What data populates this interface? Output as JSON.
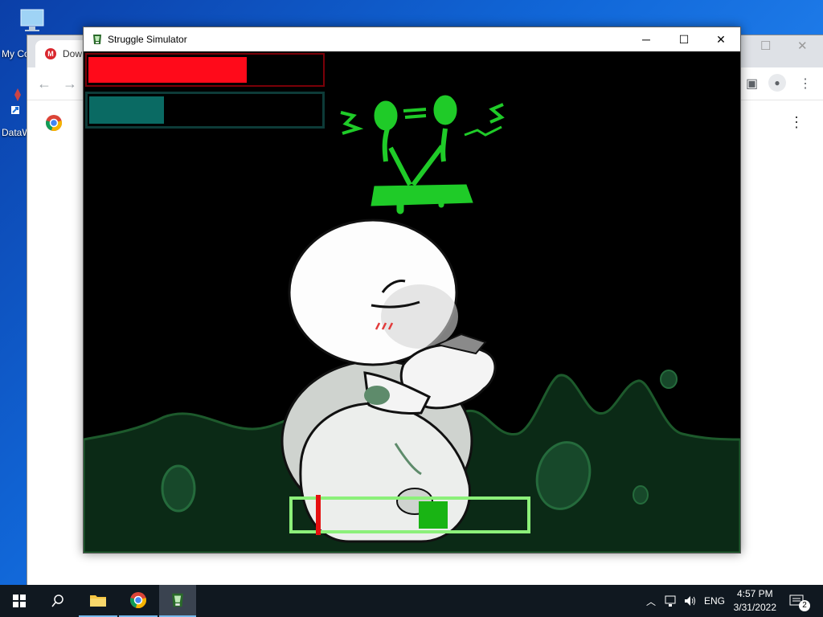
{
  "desktop": {
    "icons": [
      {
        "label": "My Co",
        "icon": "computer-icon"
      },
      {
        "label": "DataW",
        "icon": "shortcut-icon"
      }
    ]
  },
  "browser": {
    "tab_title": "Dow",
    "tab_icon": "mega-icon"
  },
  "game_window": {
    "title": "Struggle Simulator",
    "minimize": "─",
    "maximize": "☐",
    "close": "✕",
    "health_bar": {
      "fill_fraction": 0.68,
      "color": "#ff0a1a",
      "border": "#7a0008"
    },
    "stamina_bar": {
      "fill_fraction": 0.32,
      "color": "#0a6a63",
      "border": "#0d3b38"
    },
    "struggle_meter": {
      "marker_fraction": 0.1,
      "target_fraction": 0.6,
      "frame_color": "#8cf07a",
      "target_color": "#19b414",
      "marker_color": "#e51010"
    }
  },
  "taskbar": {
    "start_icon": "windows-icon",
    "search_icon": "search-icon",
    "apps": [
      "file-explorer-icon",
      "chrome-icon",
      "struggle-simulator-icon"
    ],
    "language": "ENG",
    "time": "4:57 PM",
    "date": "3/31/2022",
    "notification_count": "2"
  }
}
